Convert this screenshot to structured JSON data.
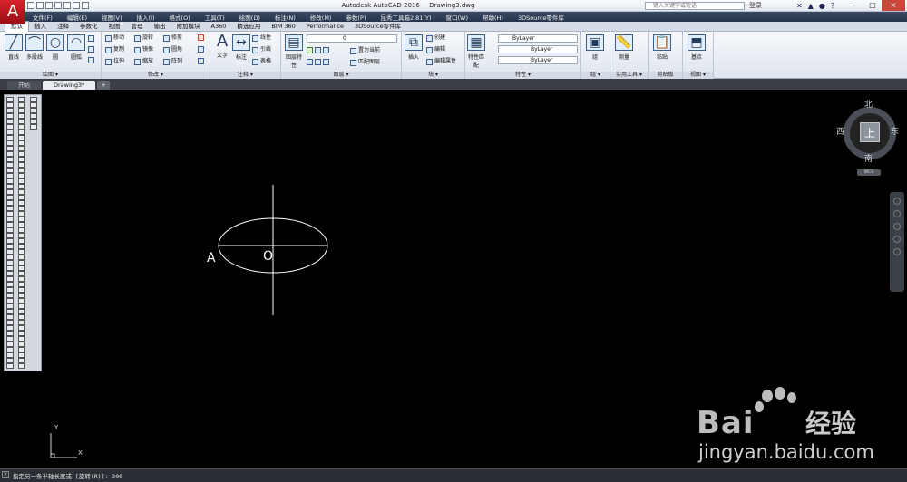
{
  "app": {
    "logo": "A",
    "title_app": "Autodesk AutoCAD 2016",
    "title_file": "Drawing3.dwg",
    "search_placeholder": "键入关键字或短语",
    "login": "登录"
  },
  "menubar": [
    "文件(F)",
    "编辑(E)",
    "视图(V)",
    "插入(I)",
    "格式(O)",
    "工具(T)",
    "绘图(D)",
    "标注(N)",
    "修改(M)",
    "参数(P)",
    "昆秀工具箱2.81(Y)",
    "窗口(W)",
    "帮助(H)",
    "3DSource零件库"
  ],
  "ribbon_tabs": [
    "默认",
    "插入",
    "注释",
    "参数化",
    "视图",
    "管理",
    "输出",
    "附加模块",
    "A360",
    "精选应用",
    "BIM 360",
    "Performance",
    "3DSource零件库"
  ],
  "ribbon": {
    "draw_panel": {
      "title": "绘图 ▾",
      "line": "直线",
      "polyline": "多段线",
      "circle": "圆",
      "arc": "圆弧"
    },
    "modify_panel": {
      "title": "修改 ▾",
      "move": "移动",
      "rotate": "旋转",
      "trim": "修剪",
      "copy": "复制",
      "mirror": "镜像",
      "fillet": "圆角",
      "stretch": "拉伸",
      "scale": "缩放",
      "array": "阵列"
    },
    "annotation_panel": {
      "title": "注释 ▾",
      "text": "文字",
      "dimension": "标注",
      "linear": "线性",
      "leader": "引线",
      "table": "表格"
    },
    "layers_panel": {
      "title": "图层 ▾",
      "layer_props": "图层特性",
      "layer_value": "0",
      "make_current": "置为当前",
      "match_layer": "匹配图层"
    },
    "block_panel": {
      "title": "块 ▾",
      "insert": "插入",
      "create": "创建",
      "edit": "编辑",
      "edit_attr": "编辑属性"
    },
    "properties_panel": {
      "title": "特性 ▾",
      "match": "特性匹配",
      "color": "ByLayer",
      "linetype": "ByLayer",
      "lineweight": "ByLayer"
    },
    "groups_panel": {
      "title": "组 ▾",
      "group": "组"
    },
    "utilities_panel": {
      "title": "实用工具 ▾",
      "measure": "测量"
    },
    "clipboard_panel": {
      "title": "剪贴板",
      "paste": "粘贴"
    },
    "view_panel": {
      "title": "视图 ▾",
      "base": "基点"
    }
  },
  "doc_tabs": {
    "start": "开始",
    "drawing": "Drawing3*",
    "plus": "+"
  },
  "viewcube": {
    "north": "北",
    "south": "南",
    "east": "东",
    "west": "西",
    "face": "上",
    "wcs": "WCS"
  },
  "drawing": {
    "label_a": "A",
    "label_o": "O"
  },
  "ucs": {
    "y": "Y",
    "x": "X"
  },
  "watermark": {
    "brand": "Bai",
    "brand_cn": "经验",
    "url": "jingyan.baidu.com"
  },
  "command": {
    "close": "×",
    "text": "指定另一条半轴长度或 [旋转(R)]: 300"
  }
}
